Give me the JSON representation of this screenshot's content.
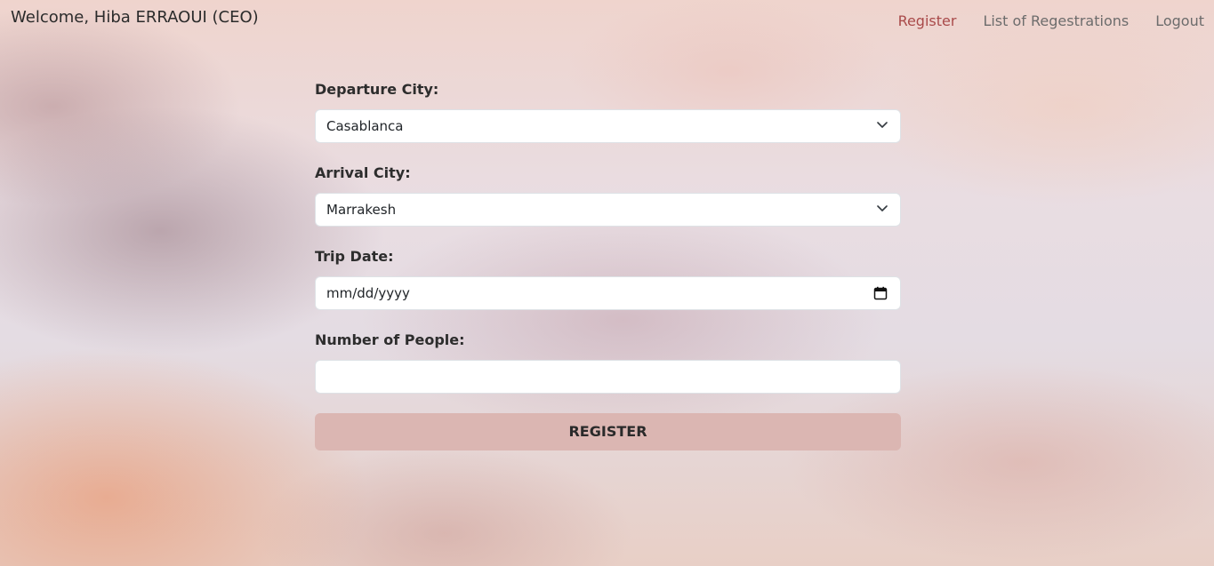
{
  "header": {
    "welcome_text": "Welcome, Hiba ERRAOUI (CEO)",
    "nav": [
      {
        "label": "Register",
        "active": true
      },
      {
        "label": "List of Regestrations",
        "active": false
      },
      {
        "label": "Logout",
        "active": false
      }
    ]
  },
  "form": {
    "departure": {
      "label": "Departure City:",
      "value": "Casablanca"
    },
    "arrival": {
      "label": "Arrival City:",
      "value": "Marrakesh"
    },
    "date": {
      "label": "Trip Date:",
      "placeholder": "mm/dd/yyyy",
      "value": ""
    },
    "people": {
      "label": "Number of People:",
      "value": ""
    },
    "submit_label": "REGISTER"
  },
  "icons": {
    "select_arrow": "chevron-down-icon",
    "date_picker": "calendar-icon"
  },
  "colors": {
    "active_nav": "#a94a4a",
    "nav": "#6c6c6c",
    "button_bg": "#dbb6b2"
  }
}
